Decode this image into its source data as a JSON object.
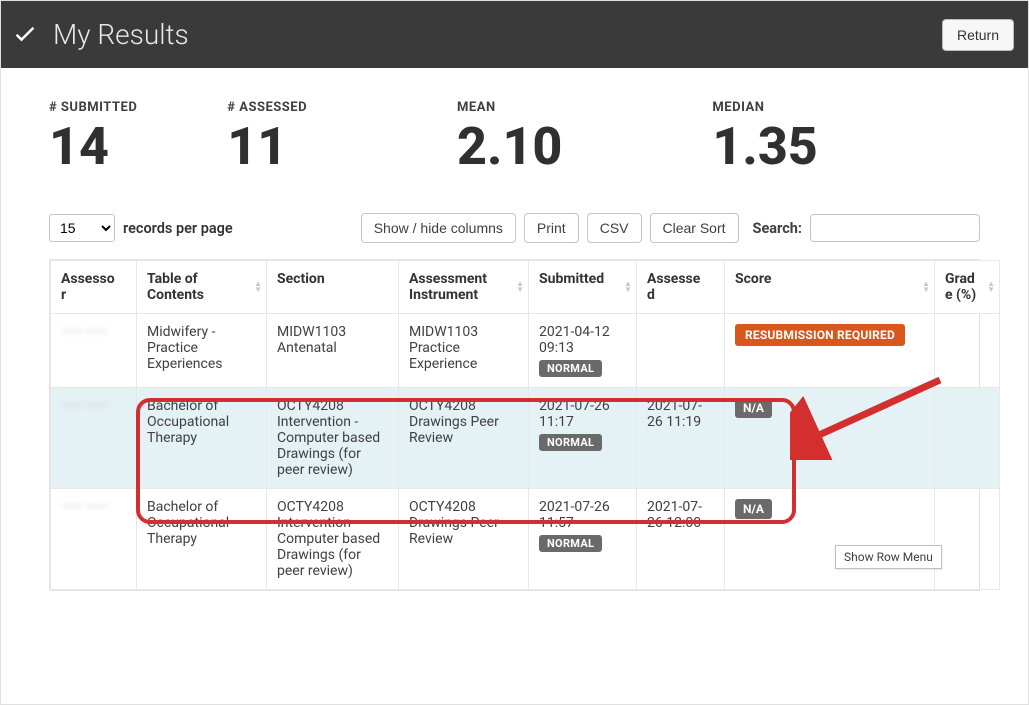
{
  "header": {
    "title": "My Results",
    "return_label": "Return"
  },
  "stats": {
    "submitted_label": "# SUBMITTED",
    "submitted_value": "14",
    "assessed_label": "# ASSESSED",
    "assessed_value": "11",
    "mean_label": "MEAN",
    "mean_value": "2.10",
    "median_label": "MEDIAN",
    "median_value": "1.35"
  },
  "controls": {
    "records_value": "15",
    "records_label": "records per page",
    "show_hide_label": "Show / hide columns",
    "print_label": "Print",
    "csv_label": "CSV",
    "clear_sort_label": "Clear Sort",
    "search_label": "Search:",
    "search_placeholder": ""
  },
  "columns": {
    "assessor": "Assessor",
    "toc": "Table of Contents",
    "section": "Section",
    "instrument": "Assessment Instrument",
    "submitted": "Submitted",
    "assessed": "Assessed",
    "score": "Score",
    "grade": "Grade (%)"
  },
  "rows": [
    {
      "assessor": "—— ——",
      "toc": "Midwifery - Practice Experiences",
      "section": "MIDW1103 Antenatal",
      "instrument": "MIDW1103 Practice Experience",
      "submitted_date": "2021-04-12 09:13",
      "submitted_tag": "NORMAL",
      "assessed": "",
      "score_badge": "RESUBMISSION REQUIRED",
      "score_badge_type": "resub",
      "grade": ""
    },
    {
      "assessor": "—— ——",
      "toc": "Bachelor of Occupational Therapy",
      "section": "OCTY4208 Intervention - Computer based Drawings (for peer review)",
      "instrument": "OCTY4208 Drawings Peer Review",
      "submitted_date": "2021-07-26 11:17",
      "submitted_tag": "NORMAL",
      "assessed": "2021-07-26 11:19",
      "score_badge": "N/A",
      "score_badge_type": "na",
      "grade": ""
    },
    {
      "assessor": "—— ——",
      "toc": "Bachelor of Occupational Therapy",
      "section": "OCTY4208 Intervention - Computer based Drawings (for peer review)",
      "instrument": "OCTY4208 Drawings Peer Review",
      "submitted_date": "2021-07-26 11:57",
      "submitted_tag": "NORMAL",
      "assessed": "2021-07-26 12:00",
      "score_badge": "N/A",
      "score_badge_type": "na",
      "grade": ""
    }
  ],
  "tooltip": "Show Row Menu"
}
